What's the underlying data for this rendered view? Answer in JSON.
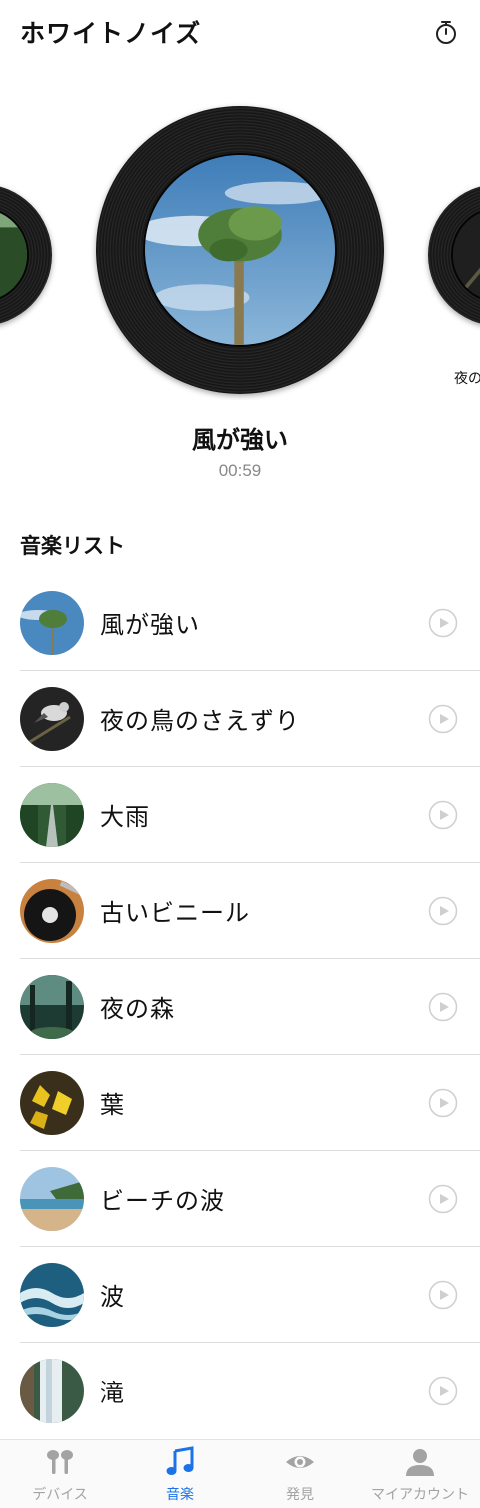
{
  "header": {
    "title": "ホワイトノイズ",
    "timer_icon": "stopwatch-icon"
  },
  "carousel": {
    "current": {
      "title": "風が強い",
      "time": "00:59"
    },
    "next_caption": "夜の"
  },
  "list": {
    "heading": "音楽リスト",
    "items": [
      {
        "title": "風が強い"
      },
      {
        "title": "夜の鳥のさえずり"
      },
      {
        "title": "大雨"
      },
      {
        "title": "古いビニール"
      },
      {
        "title": "夜の森"
      },
      {
        "title": "葉"
      },
      {
        "title": "ビーチの波"
      },
      {
        "title": "波"
      },
      {
        "title": "滝"
      }
    ]
  },
  "tabbar": {
    "tabs": [
      {
        "label": "デバイス",
        "icon": "earbuds-icon",
        "active": false
      },
      {
        "label": "音楽",
        "icon": "music-note-icon",
        "active": true
      },
      {
        "label": "発見",
        "icon": "eye-icon",
        "active": false
      },
      {
        "label": "マイアカウント",
        "icon": "person-icon",
        "active": false
      }
    ]
  },
  "colors": {
    "accent": "#1a73e8",
    "inactive": "#a3a3a3",
    "divider": "#dedede"
  }
}
